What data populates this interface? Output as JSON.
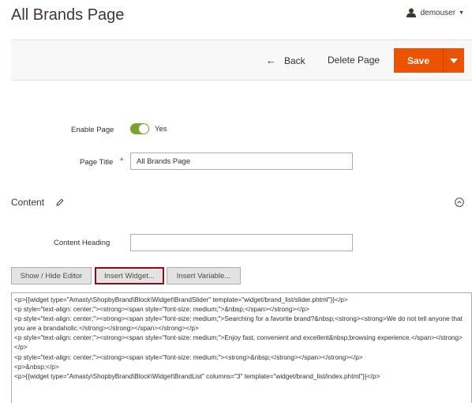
{
  "header": {
    "title": "All Brands Page",
    "user": "demouser"
  },
  "actions": {
    "back_label": "Back",
    "back_arrow": "←",
    "delete_label": "Delete Page",
    "save_label": "Save"
  },
  "form": {
    "enable_label": "Enable Page",
    "enable_value": "Yes",
    "title_label": "Page Title",
    "title_required": "*",
    "title_value": "All Brands Page",
    "section_title": "Content",
    "heading_label": "Content Heading",
    "heading_value": ""
  },
  "editor": {
    "show_hide_label": "Show / Hide Editor",
    "insert_widget_label": "Insert Widget...",
    "insert_variable_label": "Insert Variable...",
    "content": "<p>{{widget type=\"Amasty\\ShopbyBrand\\Block\\Widget\\BrandSlider\" template=\"widget/brand_list/slider.phtml\"}}</p>\n<p style=\"text-align: center;\"><strong><span style=\"font-size: medium;\">&nbsp;</span></strong></p>\n<p style=\"text-align: center;\"><strong><span style=\"font-size: medium;\">Searching for a favorite brand?&nbsp;<strong><strong>We do not tell anyone that you are a brandaholic.</strong></strong></span></strong></p>\n<p style=\"text-align: center;\"><strong><span style=\"font-size: medium;\">Enjoy fast, convenient and excellent&nbsp;browsing experience.</span></strong></p>\n<p style=\"text-align: center;\"><strong><span style=\"font-size: medium;\"><strong>&nbsp;</strong></span></strong></p>\n<p>&nbsp;</p>\n<p>{{widget type=\"Amasty\\ShopbyBrand\\Block\\Widget\\BrandList\" columns=\"3\" template=\"widget/brand_list/index.phtml\"}}</p>"
  },
  "icons": {
    "user": "user-icon",
    "pencil": "pencil-icon",
    "collapse": "chevron-up-circle-icon",
    "dropdown": "chevron-down-icon"
  },
  "colors": {
    "save_button": "#eb5202",
    "toggle_on": "#79a22e",
    "highlight_border": "#8a0e1a",
    "required": "#e22626"
  }
}
